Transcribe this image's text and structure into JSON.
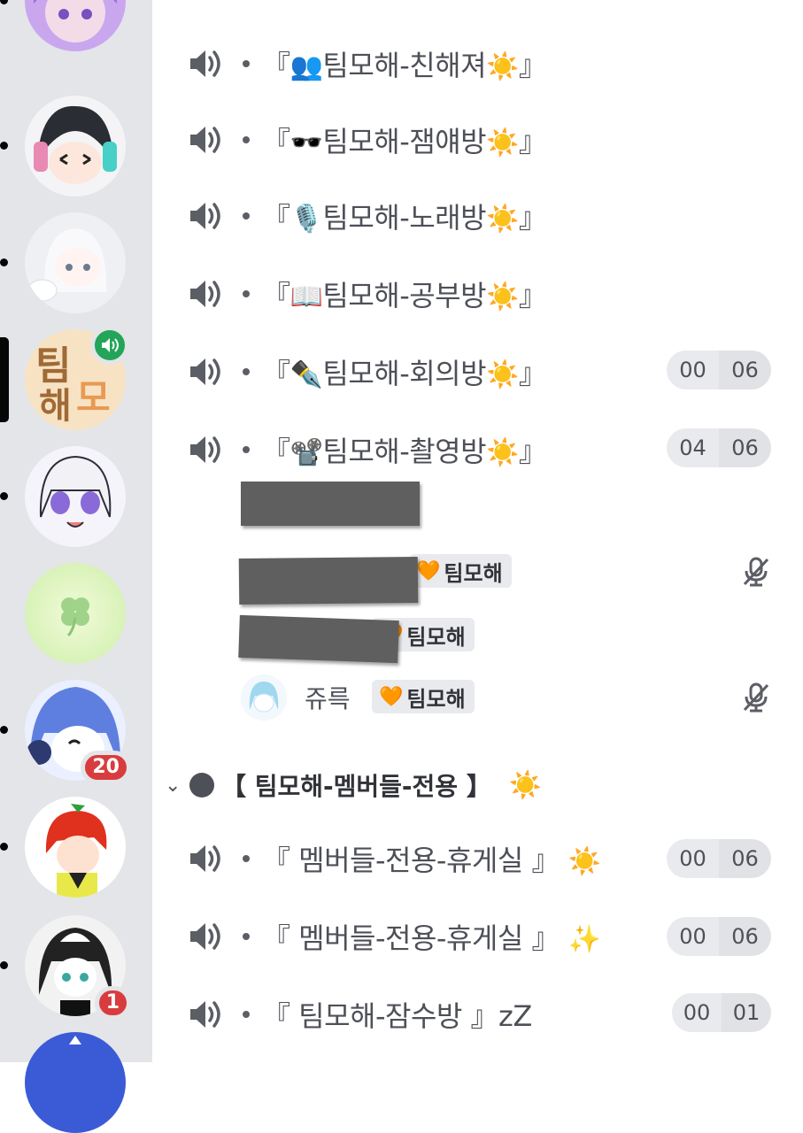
{
  "servers": [
    {
      "name": "purple-avatar",
      "badge": null,
      "voice": false,
      "active": false
    },
    {
      "name": "boy-headphones-avatar",
      "badge": null,
      "voice": false,
      "active": false
    },
    {
      "name": "white-cat-avatar",
      "badge": null,
      "voice": false,
      "active": false
    },
    {
      "name": "teammohae-logo",
      "badge": null,
      "voice": true,
      "active": true,
      "logo_text_1": "팀",
      "logo_text_2": "해",
      "logo_text_3": "모"
    },
    {
      "name": "chibi-girl-avatar",
      "badge": null,
      "voice": false,
      "active": false
    },
    {
      "name": "clover-avatar",
      "badge": null,
      "voice": false,
      "active": false
    },
    {
      "name": "blue-hair-avatar",
      "badge": "20",
      "voice": false,
      "active": false
    },
    {
      "name": "red-hair-avatar",
      "badge": null,
      "voice": false,
      "active": false
    },
    {
      "name": "monochrome-avatar",
      "badge": "1",
      "voice": false,
      "active": false
    }
  ],
  "channels_top": [
    {
      "prefix": "『",
      "emoji": "👥",
      "name": "팀모해-친해져",
      "suffix_emoji": "☀️",
      "suffix": "』",
      "counter": null
    },
    {
      "prefix": "『",
      "emoji": "🕶️",
      "name": "팀모해-잼얘방",
      "suffix_emoji": "☀️",
      "suffix": "』",
      "counter": null
    },
    {
      "prefix": "『",
      "emoji": "🎙️",
      "name": "팀모해-노래방",
      "suffix_emoji": "☀️",
      "suffix": "』",
      "counter": null
    },
    {
      "prefix": "『",
      "emoji": "📖",
      "name": "팀모해-공부방",
      "suffix_emoji": "☀️",
      "suffix": "』",
      "counter": null
    },
    {
      "prefix": "『",
      "emoji": "✒️",
      "name": "팀모해-회의방",
      "suffix_emoji": "☀️",
      "suffix": "』",
      "counter": {
        "current": "00",
        "limit": "06"
      }
    },
    {
      "prefix": "『",
      "emoji": "📽️",
      "name": "팀모해-촬영방",
      "suffix_emoji": "☀️",
      "suffix": "』",
      "counter": {
        "current": "04",
        "limit": "06"
      }
    }
  ],
  "voice_users": [
    {
      "name": "",
      "tag_heart": "",
      "tag": "",
      "muted": false
    },
    {
      "name": "",
      "tag_heart": "🧡",
      "tag": "팀모해",
      "muted": true
    },
    {
      "name": "",
      "tag_heart": "🧡",
      "tag": "팀모해",
      "muted": false
    },
    {
      "name": "쥬륵",
      "tag_heart": "🧡",
      "tag": "팀모해",
      "muted": true
    }
  ],
  "category": {
    "chevron": "⌄",
    "title": "【 팀모해-멤버들-전용 】",
    "emoji": "☀️"
  },
  "channels_bottom": [
    {
      "text": "『 멤버들-전용-휴게실 』",
      "emoji": "☀️",
      "counter": {
        "current": "00",
        "limit": "06"
      }
    },
    {
      "text": "『 멤버들-전용-휴게실 』",
      "emoji": "✨",
      "counter": {
        "current": "00",
        "limit": "06"
      }
    },
    {
      "text": "『 팀모해-잠수방 』zZ",
      "emoji": "",
      "counter": {
        "current": "00",
        "limit": "01"
      }
    }
  ],
  "colors": {
    "rail_bg": "#e3e5e8",
    "badge_red": "#d83c3e",
    "voice_green": "#23a559",
    "text": "#4e5058"
  }
}
